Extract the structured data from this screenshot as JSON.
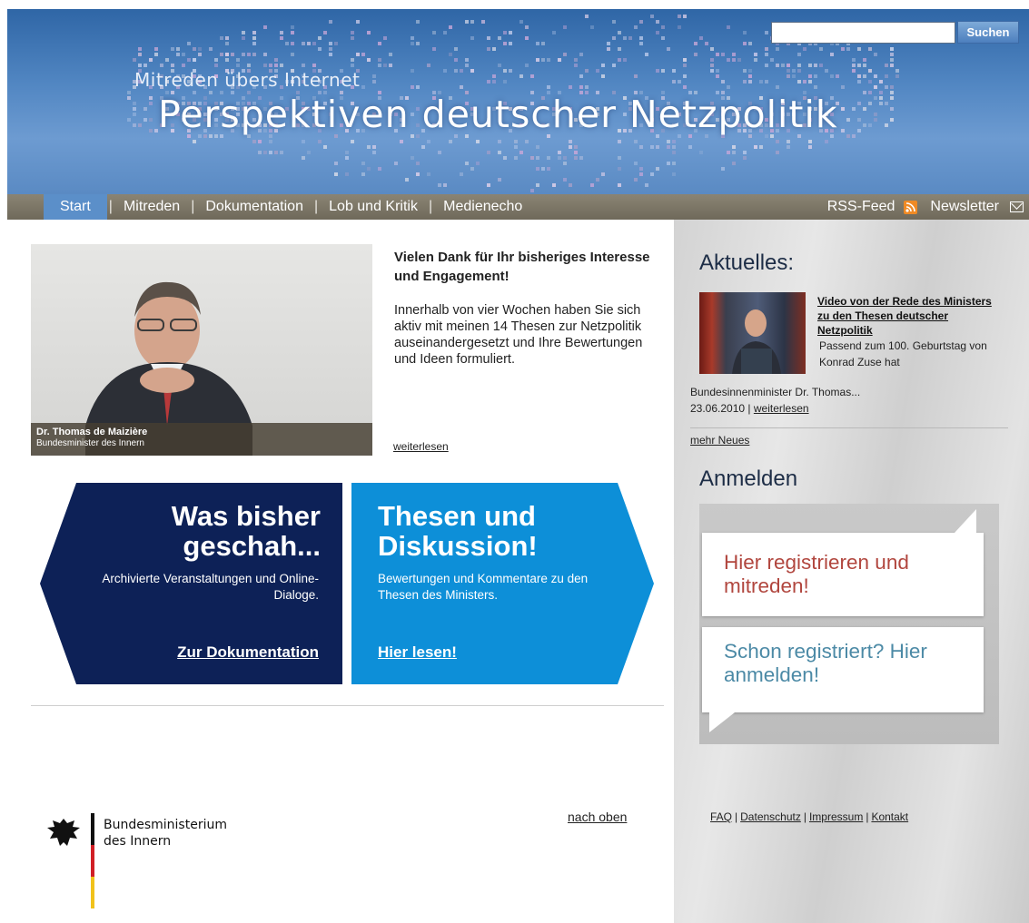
{
  "header": {
    "subtitle": "Mitreden übers Internet",
    "title": "Perspektiven deutscher Netzpolitik",
    "search_placeholder": "",
    "search_button": "Suchen"
  },
  "nav": {
    "items": [
      "Start",
      "Mitreden",
      "Dokumentation",
      "Lob und Kritik",
      "Medienecho"
    ],
    "separator": "|",
    "rss": "RSS-Feed",
    "newsletter": "Newsletter"
  },
  "hero": {
    "caption_name": "Dr. Thomas de Maizière",
    "caption_role": "Bundesminister des Innern"
  },
  "intro": {
    "headline": "Vielen Dank für Ihr bisheriges Interesse und Engagement!",
    "body": "Innerhalb von vier Wochen haben Sie sich aktiv mit meinen 14 Thesen zur Netzpolitik auseinandergesetzt und Ihre Bewertungen und Ideen formuliert.",
    "more": "weiterlesen"
  },
  "cards": {
    "left": {
      "title": "Was bisher geschah...",
      "subtitle": "Archivierte Veranstaltungen und Online-Dialoge.",
      "link": "Zur Dokumentation"
    },
    "right": {
      "title": "Thesen und Diskussion!",
      "subtitle": "Bewertungen und Kommentare zu den Thesen des Ministers.",
      "link": "Hier lesen!"
    }
  },
  "footer_left": {
    "logo_line1": "Bundesministerium",
    "logo_line2": "des Innern",
    "back_to_top": "nach oben"
  },
  "sidebar": {
    "news_heading": "Aktuelles:",
    "news_title": "Video von der Rede des Ministers zu den Thesen deutscher Netzpolitik",
    "news_teaser_a": "Passend zum 100. Geburtstag von Konrad Zuse hat",
    "news_teaser_b": "Bundesinnenminister Dr. Thomas...",
    "news_date": "23.06.2010",
    "news_date_sep": " | ",
    "news_more": "weiterlesen",
    "more_news": "mehr Neues",
    "login_heading": "Anmelden",
    "register_text": "Hier registrieren und mitreden!",
    "login_text": "Schon registriert? Hier anmelden!",
    "footer": [
      "FAQ",
      "Datenschutz",
      "Impressum",
      "Kontakt"
    ],
    "footer_sep": "|"
  },
  "colors": {
    "nav_active": "#5b8fc9",
    "card_dark": "#0d2157",
    "card_light": "#0d8fd8",
    "register_red": "#b1463e",
    "login_blue": "#4c8aa6"
  }
}
